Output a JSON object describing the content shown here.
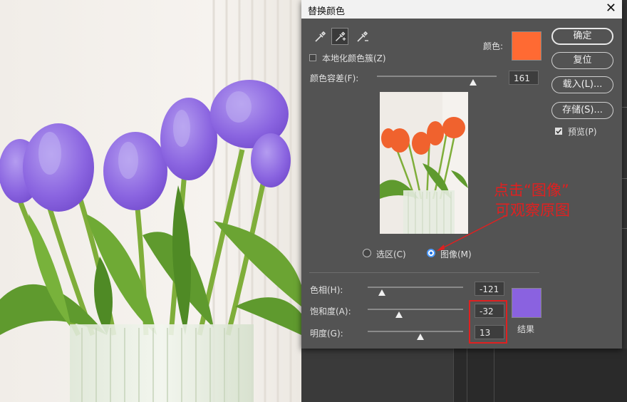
{
  "dialog": {
    "title": "替换颜色",
    "close_glyph": "✕",
    "localize_label": "本地化颜色簇(Z)",
    "color_label": "颜色:",
    "fuzziness_label": "颜色容差(F):",
    "fuzziness_value": "161",
    "fuzziness_level": 0.9,
    "view_options": [
      "选区(C)",
      "图像(M)"
    ],
    "selected_view": "图像(M)",
    "hue_label": "色相(H):",
    "hue_value": "-121",
    "saturation_label": "饱和度(A):",
    "saturation_value": "-32",
    "lightness_label": "明度(G):",
    "lightness_value": "13",
    "result_label": "结果",
    "preview_label": "预览(P)",
    "preview_checked": true,
    "localize_checked": false
  },
  "buttons": {
    "ok": "确定",
    "reset": "复位",
    "load": "载入(L)...",
    "save": "存储(S)..."
  },
  "tools": [
    "eyedropper-icon",
    "eyedropper-plus-icon",
    "eyedropper-minus-icon"
  ],
  "annotation": {
    "line1": "点击“图像”",
    "line2": "可观察原图"
  },
  "colors": {
    "selected_color": "#ff6a33",
    "result_color": "#8a62e0",
    "annotation_red": "#e02020",
    "dialog_bg": "#535353"
  }
}
